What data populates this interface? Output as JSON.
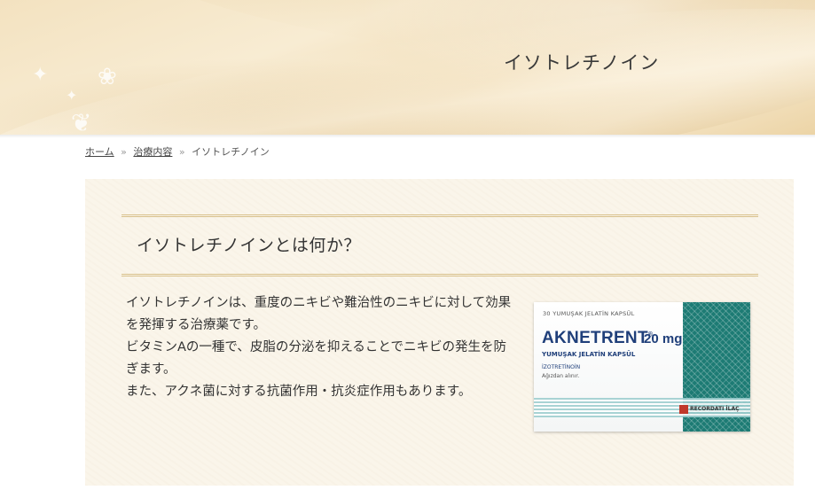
{
  "header": {
    "title": "イソトレチノイン"
  },
  "breadcrumb": {
    "home": "ホーム",
    "separator": "»",
    "treatment": "治療内容",
    "current": "イソトレチノイン"
  },
  "section": {
    "heading": "イソトレチノインとは何か？",
    "paragraphs": [
      "イソトレチノインは、重度のニキビや難治性のニキビに対して効果を発揮する治療薬です。",
      "ビタミンAの一種で、皮脂の分泌を抑えることでニキビの発生を防ぎます。",
      "また、アクネ菌に対する抗菌作用・抗炎症作用もあります。"
    ]
  },
  "product_image": {
    "capsule_count": "30 YUMUŞAK JELATİN KAPSÜL",
    "brand": "AKNETRENT",
    "registered": "®",
    "dose": "20 mg",
    "subtitle": "YUMUŞAK JELATİN KAPSÜL",
    "ingredient": "İZOTRETİNOİN",
    "route": "Ağızdan alınır.",
    "maker": "RECORDATI İLAÇ"
  },
  "colors": {
    "accent_border": "#d8c08a",
    "box_teal": "#1d7b74",
    "brand_blue": "#1f3f7a"
  }
}
